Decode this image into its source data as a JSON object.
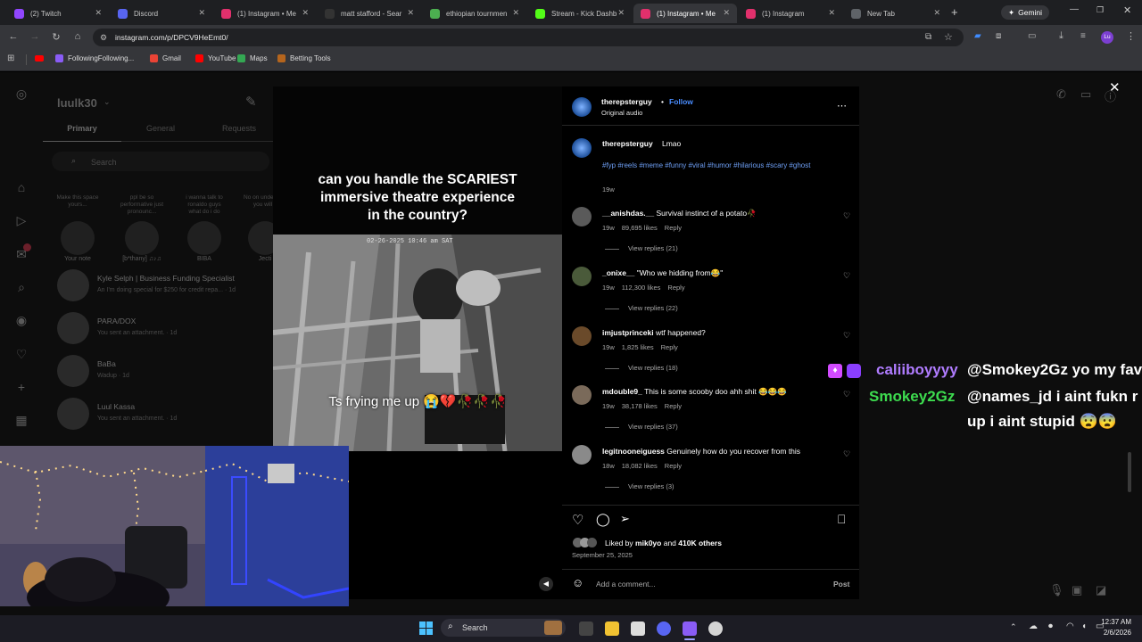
{
  "browser": {
    "tabs": [
      {
        "title": "(2) Twitch",
        "color": "#9146ff"
      },
      {
        "title": "Discord",
        "color": "#5865f2"
      },
      {
        "title": "(1) Instagram • Me",
        "color": "#e1306c"
      },
      {
        "title": "matt stafford - Sear",
        "color": "#333333"
      },
      {
        "title": "ethiopian tournmen",
        "color": "#4caf50"
      },
      {
        "title": "Stream - Kick Dashb",
        "color": "#53fc18"
      },
      {
        "title": "(1) Instagram • Me",
        "color": "#e1306c"
      },
      {
        "title": "(1) Instagram",
        "color": "#e1306c"
      },
      {
        "title": "New Tab",
        "color": "#5f6368"
      }
    ],
    "gemini_label": "Gemini",
    "url": "instagram.com/p/DPCV9HeEmt0/",
    "profile_initials": "Lu",
    "bookmarks": [
      "FollowingFollowing...",
      "Gmail",
      "YouTube",
      "Maps",
      "Betting Tools"
    ]
  },
  "dm": {
    "username": "luulk30",
    "tabs": [
      "Primary",
      "General",
      "Requests"
    ],
    "search_placeholder": "Search",
    "notes": [
      {
        "text": "Make this space yours...",
        "label": "Your note"
      },
      {
        "text": "ppl be so performative just pronounc...",
        "label": "[b*thany] ♫♪♫"
      },
      {
        "text": "i wanna talk to ronaldo guys what do i do",
        "label": "BIBA"
      },
      {
        "text": "No on understoo you will s",
        "label": "Jecti"
      }
    ],
    "threads": [
      {
        "name": "Kyle Selph | Business Funding Specialist",
        "sub": "An I'm doing special for $250 for credit repa... · 1d"
      },
      {
        "name": "PARA/DOX",
        "sub": "You sent an attachment. · 1d"
      },
      {
        "name": "BaBa",
        "sub": "Wadup · 1d"
      },
      {
        "name": "Luul Kassa",
        "sub": "You sent an attachment. · 1d"
      }
    ]
  },
  "post": {
    "caption_line1": "can you handle the SCARIEST",
    "caption_line2": "immersive theatre experience",
    "caption_line3": "in the country?",
    "subtitle": "Ts frying me up 😭💔🥀🥀🥀",
    "timestamp_overlay": "02-26-2025 10:46 am SAT",
    "author": "therepsterguy",
    "follow": "Follow",
    "audio": "Original audio",
    "caption_user": "therepsterguy",
    "caption_text": "Lmao",
    "hashtags": "#fyp #reels #meme #funny #viral #humor #hilarious #scary #ghost",
    "caption_age": "19w",
    "comments": [
      {
        "user": "__anishdas.__",
        "text": "Survival instinct of a potato🥀",
        "age": "19w",
        "likes": "89,695 likes",
        "reply": "Reply",
        "replies": "View replies (21)"
      },
      {
        "user": "_onixe__",
        "text": "\"Who we hidding from😂\"",
        "age": "19w",
        "likes": "112,300 likes",
        "reply": "Reply",
        "replies": "View replies (22)"
      },
      {
        "user": "imjustprinceki",
        "text": "wtf happened?",
        "age": "19w",
        "likes": "1,825 likes",
        "reply": "Reply",
        "replies": "View replies (18)"
      },
      {
        "user": "mdouble9_",
        "text": "This is some scooby doo ahh shit 😂😂😂",
        "age": "19w",
        "likes": "38,178 likes",
        "reply": "Reply",
        "replies": "View replies (37)"
      },
      {
        "user": "legitnooneiguess",
        "text": "Genuinely how do you recover from this",
        "age": "18w",
        "likes": "18,082 likes",
        "reply": "Reply",
        "replies": "View replies (3)"
      }
    ],
    "liked_by_prefix": "Liked by",
    "liked_by_user": "mik0yo",
    "liked_by_and": "and",
    "liked_by_others": "410K others",
    "date": "September 25, 2025",
    "add_comment_placeholder": "Add a comment...",
    "post_button": "Post"
  },
  "chat_overlay": [
    {
      "user": "caliiboyyyy",
      "message": "@Smokey2Gz yo my fav",
      "user_color": "#b07cff"
    },
    {
      "user": "Smokey2Gz",
      "message": "@names_jd i aint fukn r",
      "message2": "up i aint stupid 😨😨",
      "user_color": "#3ddc4f"
    }
  ],
  "taskbar": {
    "search_label": "Search",
    "time": "12:37 AM",
    "date": "2/6/2026"
  }
}
